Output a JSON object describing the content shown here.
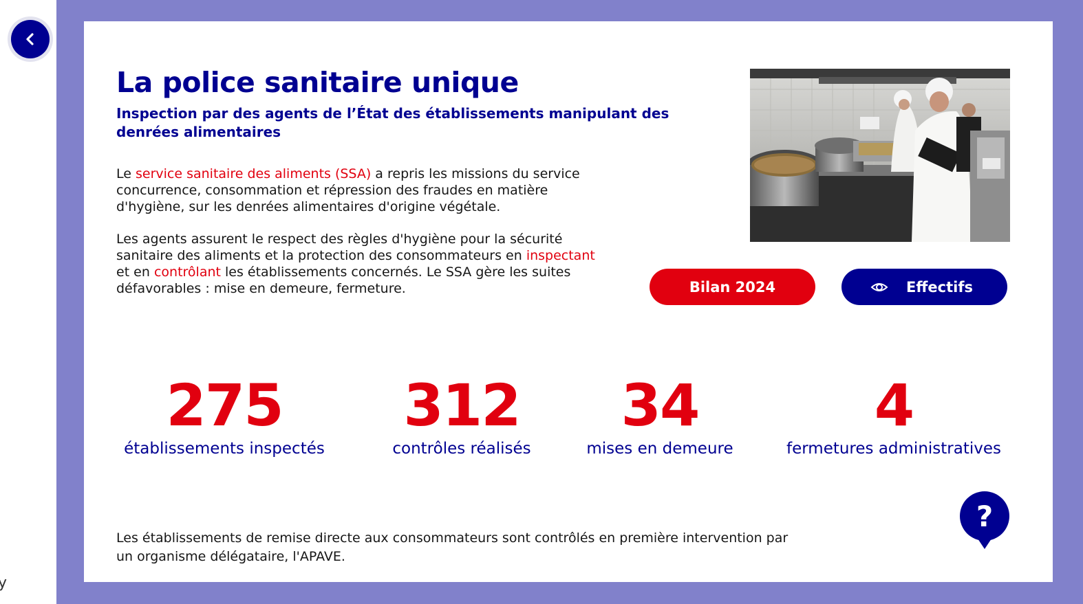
{
  "nav": {
    "back_icon": "chevron-left-icon",
    "left_fragment": "y"
  },
  "header": {
    "title": "La police sanitaire unique",
    "subtitle": "Inspection par des agents de l’État des établissements manipulant des denrées alimentaires"
  },
  "body": {
    "p1_prefix": "Le ",
    "p1_link": "service sanitaire des aliments (SSA)",
    "p1_rest": " a repris les missions du service concurrence, consommation et répression des fraudes en matière d'hygiène, sur les denrées alimentaires d'origine végétale.",
    "p2_part1": "Les agents assurent le respect des règles d'hygiène pour la sécurité sanitaire des aliments et la protection des consommateurs en ",
    "p2_hl1": "inspectant",
    "p2_part2": " et en ",
    "p2_hl2": "contrôlant",
    "p2_part3": " les établissements concernés. Le SSA gère les suites défavorables : mise en demeure, fermeture."
  },
  "buttons": {
    "bilan_label": "Bilan 2024",
    "effectifs_label": "Effectifs",
    "effectifs_icon": "eye-icon"
  },
  "stats": [
    {
      "value": "275",
      "label": "établissements inspectés"
    },
    {
      "value": "312",
      "label": "contrôles réalisés"
    },
    {
      "value": "34",
      "label": "mises en demeure"
    },
    {
      "value": "4",
      "label": "fermetures administratives"
    }
  ],
  "footer": {
    "note": "Les établissements de remise directe aux consommateurs sont contrôlés en première intervention par un organisme délégataire, l'APAVE."
  },
  "help": {
    "icon": "question-icon",
    "label": "?"
  },
  "colors": {
    "primary_blue": "#000091",
    "accent_red": "#e1000f",
    "frame_purple": "#8181cb"
  }
}
